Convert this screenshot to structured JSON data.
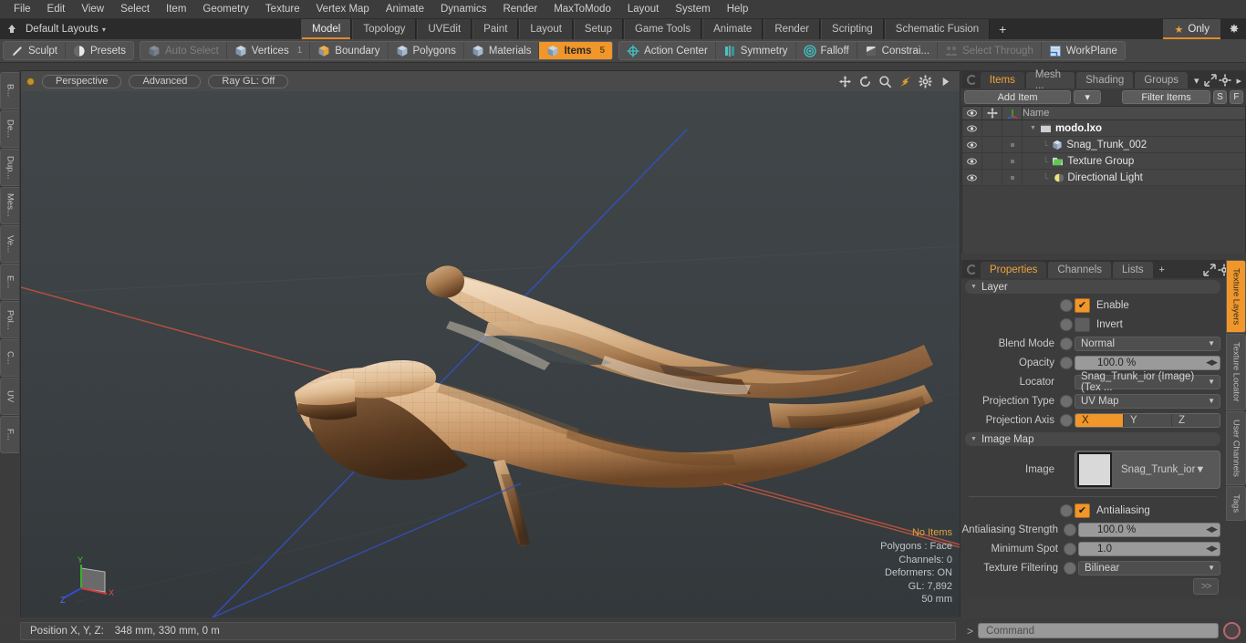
{
  "menu": {
    "items": [
      "File",
      "Edit",
      "View",
      "Select",
      "Item",
      "Geometry",
      "Texture",
      "Vertex Map",
      "Animate",
      "Dynamics",
      "Render",
      "MaxToModo",
      "Layout",
      "System",
      "Help"
    ]
  },
  "layout_bar": {
    "home_icon": "home-icon",
    "default_layouts": "Default Layouts",
    "caret": "▾",
    "tabs": [
      {
        "label": "Model",
        "active": true
      },
      {
        "label": "Topology",
        "active": false
      },
      {
        "label": "UVEdit",
        "active": false
      },
      {
        "label": "Paint",
        "active": false
      },
      {
        "label": "Layout",
        "active": false
      },
      {
        "label": "Setup",
        "active": false
      },
      {
        "label": "Game Tools",
        "active": false
      },
      {
        "label": "Animate",
        "active": false
      },
      {
        "label": "Render",
        "active": false
      },
      {
        "label": "Scripting",
        "active": false
      },
      {
        "label": "Schematic Fusion",
        "active": false
      }
    ],
    "add_tab": "+",
    "only_label": "Only",
    "star": "★",
    "gear": "✸",
    "accent": "#e08a28"
  },
  "mode_toolbar": {
    "group1": [
      {
        "label": "Sculpt",
        "icon": "pencil-icon",
        "state": "normal",
        "count": ""
      },
      {
        "label": "Presets",
        "icon": "sphere-icon",
        "state": "normal",
        "count": ""
      }
    ],
    "group2": [
      {
        "label": "Auto Select",
        "icon": "cube-icon",
        "state": "dim",
        "count": ""
      },
      {
        "label": "Vertices",
        "icon": "cube-icon",
        "state": "normal",
        "count": "1"
      },
      {
        "label": "Boundary",
        "icon": "cube-open-icon",
        "state": "normal",
        "count": ""
      },
      {
        "label": "Polygons",
        "icon": "cube-icon",
        "state": "normal",
        "count": ""
      },
      {
        "label": "Materials",
        "icon": "cube-icon",
        "state": "normal",
        "count": ""
      },
      {
        "label": "Items",
        "icon": "cube-icon",
        "state": "on",
        "count": "5"
      }
    ],
    "group3": [
      {
        "label": "Action Center",
        "icon": "crosshair-icon",
        "state": "normal",
        "count": ""
      },
      {
        "label": "Symmetry",
        "icon": "symmetry-icon",
        "state": "normal",
        "count": ""
      },
      {
        "label": "Falloff",
        "icon": "falloff-icon",
        "state": "normal",
        "count": ""
      },
      {
        "label": "Constrai...",
        "icon": "constraint-icon",
        "state": "normal",
        "count": ""
      },
      {
        "label": "Select Through",
        "icon": "select-through-icon",
        "state": "dim",
        "count": ""
      },
      {
        "label": "WorkPlane",
        "icon": "workplane-icon",
        "state": "normal",
        "count": ""
      }
    ]
  },
  "left_tabs": [
    "B...",
    "De...",
    "Dup...",
    "Mes...",
    "Ve...",
    "E...",
    "Pol...",
    "C...",
    "UV",
    "F..."
  ],
  "viewport": {
    "led": "viewport-led",
    "mode": "Perspective",
    "shading": "Advanced",
    "raygl": "Ray GL: Off",
    "icons": [
      "move-icon",
      "rotate-icon",
      "zoom-icon",
      "fit-icon",
      "gear-icon",
      "play-icon"
    ],
    "stats": {
      "selection": "No Items",
      "polygons": "Polygons : Face",
      "channels": "Channels: 0",
      "deformers": "Deformers: ON",
      "gl": "GL: 7,892",
      "scale": "50 mm"
    },
    "gizmo": {
      "x": "X",
      "y": "Y",
      "z": "Z"
    },
    "model_name": "Snag_Trunk_002"
  },
  "items_panel": {
    "tabs": [
      {
        "label": "Items",
        "active": true
      },
      {
        "label": "Mesh ...",
        "active": false
      },
      {
        "label": "Shading",
        "active": false
      },
      {
        "label": "Groups",
        "active": false
      }
    ],
    "overflow": "▾",
    "expand_icon": "expand-icon",
    "gear_icon": "gear-icon",
    "arrow_icon": "arrow-right-icon",
    "add_item": "Add Item",
    "add_item_caret": "▾",
    "filter_items": "Filter Items",
    "btn_s": "S",
    "btn_f": "F",
    "columns": [
      "eye-icon",
      "move-icon",
      "axis-icon",
      "Name"
    ],
    "rows": [
      {
        "name": "modo.lxo",
        "icon": "scene-icon",
        "depth": 0,
        "root": true
      },
      {
        "name": "Snag_Trunk_002",
        "icon": "mesh-icon",
        "depth": 1,
        "root": false
      },
      {
        "name": "Texture Group",
        "icon": "texture-group-icon",
        "depth": 1,
        "root": false
      },
      {
        "name": "Directional Light",
        "icon": "light-icon",
        "depth": 1,
        "root": false
      }
    ]
  },
  "properties_panel": {
    "tabs": [
      {
        "label": "Properties",
        "active": true
      },
      {
        "label": "Channels",
        "active": false
      },
      {
        "label": "Lists",
        "active": false
      }
    ],
    "add_tab": "+",
    "sections": {
      "layer": {
        "title": "Layer",
        "enable": {
          "label": "Enable",
          "checked": true
        },
        "invert": {
          "label": "Invert",
          "checked": false
        },
        "blend_mode": {
          "label": "Blend Mode",
          "value": "Normal"
        },
        "opacity": {
          "label": "Opacity",
          "value": "100.0 %"
        },
        "locator": {
          "label": "Locator",
          "value": "Snag_Trunk_ior (Image) (Tex ..."
        },
        "projection_type": {
          "label": "Projection Type",
          "value": "UV Map"
        },
        "projection_axis": {
          "label": "Projection Axis",
          "options": [
            "X",
            "Y",
            "Z"
          ],
          "selected": "X"
        }
      },
      "image_map": {
        "title": "Image Map",
        "image": {
          "label": "Image",
          "value": "Snag_Trunk_ior"
        },
        "antialiasing": {
          "label": "Antialiasing",
          "checked": true
        },
        "aa_strength": {
          "label": "Antialiasing Strength",
          "value": "100.0 %"
        },
        "minimum_spot": {
          "label": "Minimum Spot",
          "value": "1.0"
        },
        "texture_filtering": {
          "label": "Texture Filtering",
          "value": "Bilinear"
        },
        "more": ">>"
      }
    },
    "side_tabs": [
      {
        "label": "Texture Layers",
        "active": true
      },
      {
        "label": "Texture Locator",
        "active": false
      },
      {
        "label": "User Channels",
        "active": false
      },
      {
        "label": "Tags",
        "active": false
      }
    ]
  },
  "status_bar": {
    "position_label": "Position X, Y, Z:",
    "position_value": "348 mm, 330 mm, 0 m"
  },
  "command_bar": {
    "prompt": ">",
    "placeholder": "Command",
    "record_icon": "record-icon"
  },
  "colors": {
    "accent_orange": "#f0962a",
    "tab_underline": "#e08a28",
    "panel_bg": "#3c3c3c",
    "viewport_bg": "#3a4043",
    "axis_x": "#c55a4a",
    "axis_y": "#4fa83d",
    "axis_z": "#3b52c4"
  }
}
